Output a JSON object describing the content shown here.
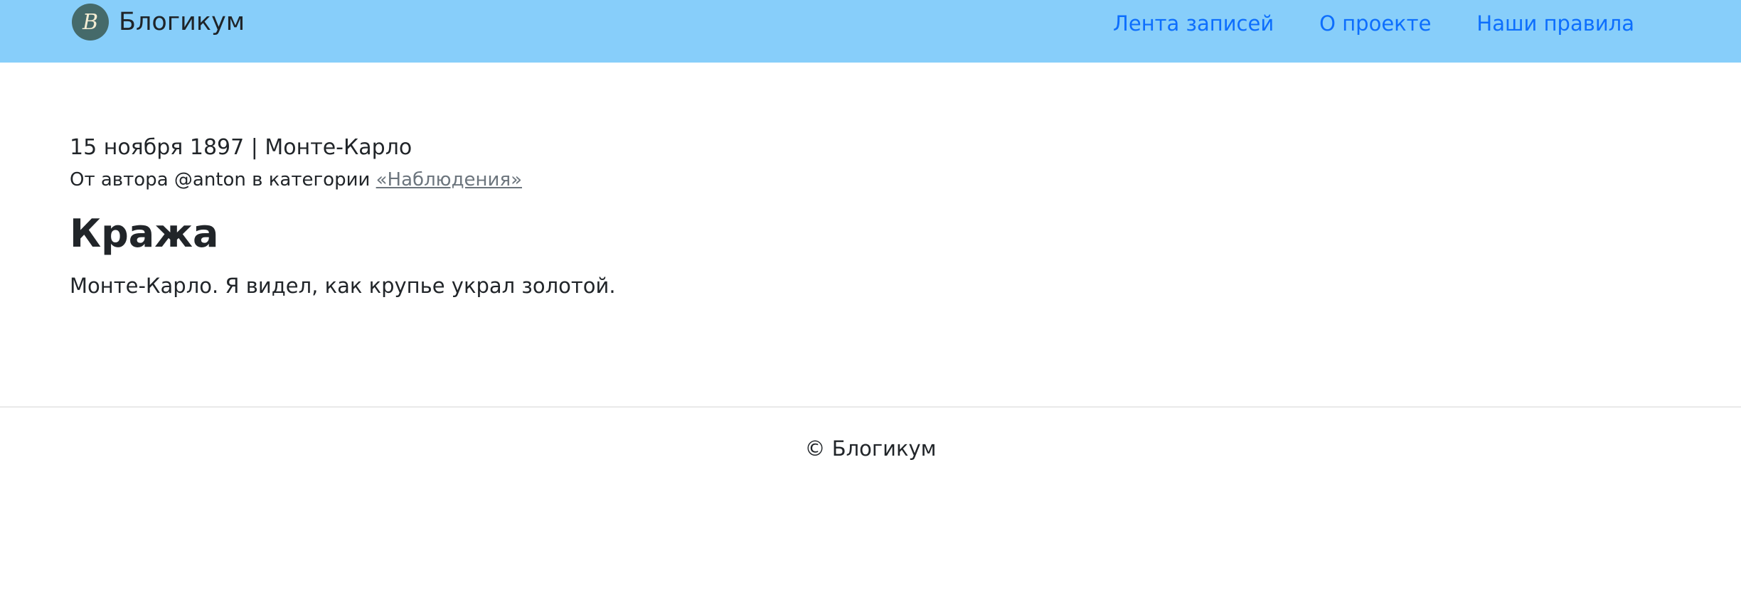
{
  "header": {
    "brand_logo_letter": "B",
    "brand_name": "Блогикум",
    "nav": [
      {
        "label": "Лента записей"
      },
      {
        "label": "О проекте"
      },
      {
        "label": "Наши правила"
      }
    ],
    "background_color": "#87cefa",
    "link_color": "#0d6efd"
  },
  "post": {
    "date_location": "15 ноября 1897 | Монте-Карло",
    "author_prefix": "От автора @anton в категории",
    "category_label": "«Наблюдения»",
    "title": "Кража",
    "text": "Монте-Карло. Я видел, как крупье украл золотой."
  },
  "footer": {
    "copyright": "© Блогикум"
  }
}
